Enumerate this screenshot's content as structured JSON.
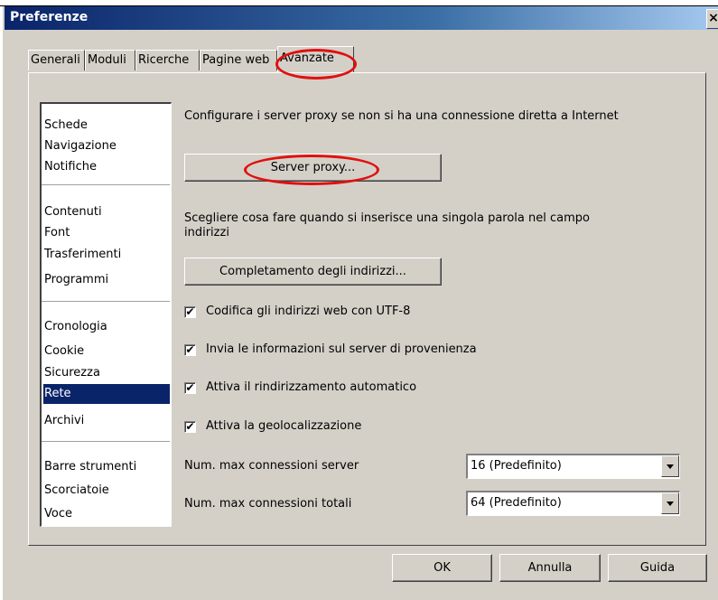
{
  "window": {
    "title": "Preferenze",
    "close_glyph": "×"
  },
  "tabs": [
    {
      "label": "Generali"
    },
    {
      "label": "Moduli"
    },
    {
      "label": "Ricerche"
    },
    {
      "label": "Pagine web"
    },
    {
      "label": "Avanzate",
      "active": true
    }
  ],
  "sidebar": {
    "items": [
      {
        "label": "Schede"
      },
      {
        "label": "Navigazione"
      },
      {
        "label": "Notifiche"
      },
      {
        "label": "Contenuti"
      },
      {
        "label": "Font"
      },
      {
        "label": "Trasferimenti"
      },
      {
        "label": "Programmi"
      },
      {
        "label": "Cronologia"
      },
      {
        "label": "Cookie"
      },
      {
        "label": "Sicurezza"
      },
      {
        "label": "Rete",
        "selected": true
      },
      {
        "label": "Archivi"
      },
      {
        "label": "Barre strumenti"
      },
      {
        "label": "Scorciatoie"
      },
      {
        "label": "Voce"
      }
    ]
  },
  "proxy": {
    "description": "Configurare i server proxy se non si ha una connessione diretta a Internet",
    "button_label": "Server proxy..."
  },
  "autocomplete": {
    "description": "Scegliere cosa fare quando si inserisce una singola parola nel campo indirizzi",
    "button_label": "Completamento degli indirizzi..."
  },
  "checkboxes": [
    {
      "label": "Codifica gli indirizzi web con UTF-8",
      "checked": true
    },
    {
      "label": "Invia le informazioni sul server di provenienza",
      "checked": true
    },
    {
      "label": "Attiva il rindirizzamento automatico",
      "checked": true
    },
    {
      "label": "Attiva la geolocalizzazione",
      "checked": true
    }
  ],
  "check_glyph": "✔",
  "connections": {
    "server_label": "Num. max connessioni server",
    "server_value": "16 (Predefinito)",
    "total_label": "Num. max connessioni totali",
    "total_value": "64 (Predefinito)"
  },
  "footer": {
    "ok_label": "OK",
    "cancel_label": "Annulla",
    "help_label": "Guida"
  },
  "colors": {
    "selection": "#0a246a",
    "annotation_red": "#e01010",
    "face": "#d4d0c8"
  }
}
